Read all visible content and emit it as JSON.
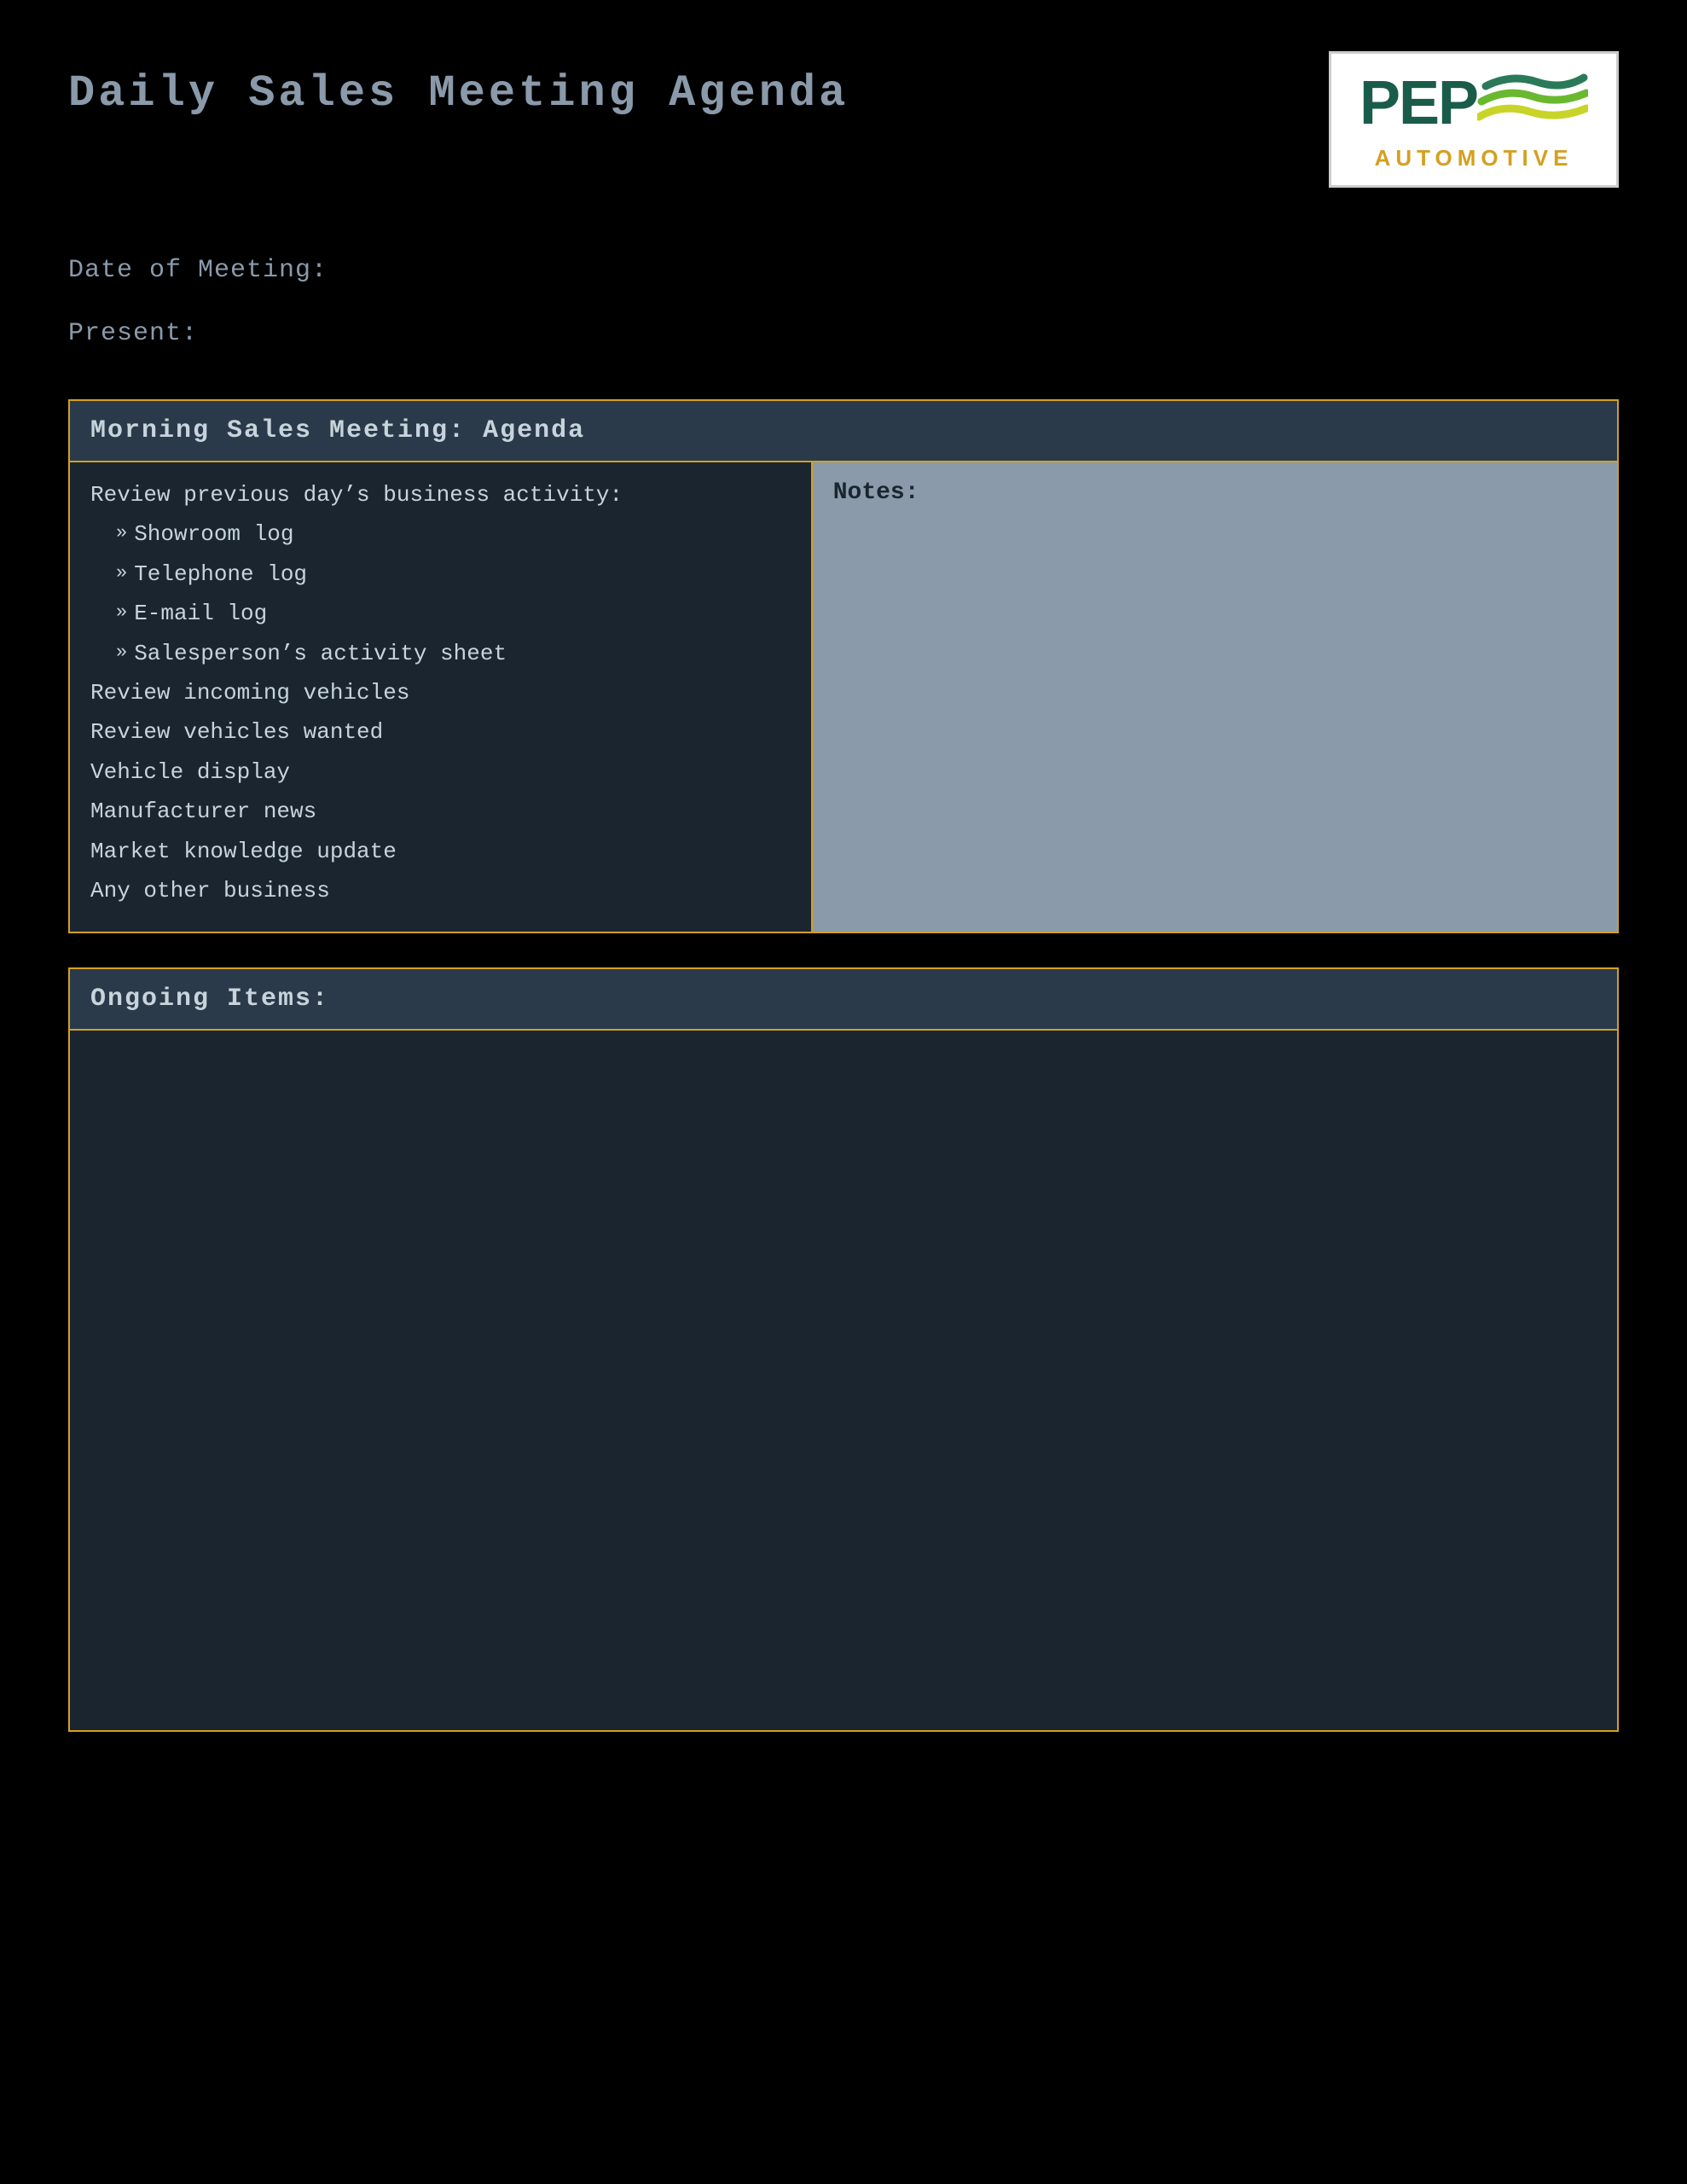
{
  "page": {
    "title": "Daily Sales Meeting Agenda",
    "background_color": "#000000"
  },
  "logo": {
    "company_name": "PEP",
    "tagline": "AUTOMOTIVE",
    "alt_text": "PEP Automotive Logo"
  },
  "meta": {
    "date_label": "Date of Meeting:",
    "present_label": "Present:"
  },
  "morning_section": {
    "header": "Morning Sales Meeting: Agenda",
    "left_column": {
      "review_label": "Review previous day’s business activity:",
      "sub_items": [
        "Showroom log",
        "Telephone log",
        "E-mail log",
        "Salesperson’s activity sheet"
      ],
      "other_items": [
        "Review incoming vehicles",
        "Review vehicles wanted",
        "Vehicle display",
        "Manufacturer news",
        "Market knowledge update",
        "Any other business"
      ]
    },
    "right_column": {
      "label": "Notes:"
    }
  },
  "ongoing_section": {
    "header": "Ongoing Items:"
  },
  "colors": {
    "gold_border": "#d4a020",
    "dark_bg": "#1a2530",
    "header_bg": "#2a3a4a",
    "notes_bg": "#8a9aaa",
    "text_color": "#c8d4dc",
    "meta_text": "#8a9aaa"
  }
}
